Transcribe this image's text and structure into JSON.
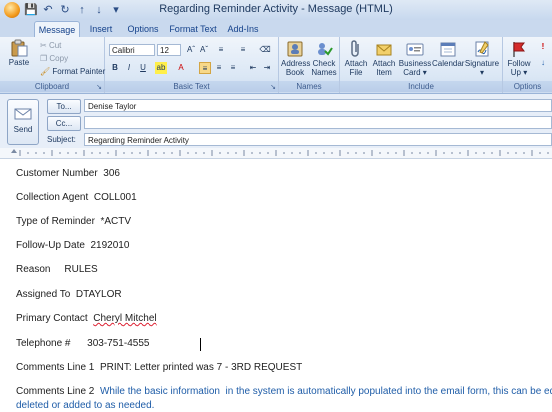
{
  "window": {
    "title": "Regarding Reminder Activity - Message (HTML)"
  },
  "tabs": [
    "Message",
    "Insert",
    "Options",
    "Format Text",
    "Add-Ins"
  ],
  "clipboard": {
    "paste": "Paste",
    "cut": "Cut",
    "copy": "Copy",
    "format_painter": "Format Painter",
    "group": "Clipboard"
  },
  "basic_text": {
    "font": "Calibri",
    "size": "12",
    "group": "Basic Text"
  },
  "names": {
    "address_book": [
      "Address",
      "Book"
    ],
    "check_names": [
      "Check",
      "Names"
    ],
    "group": "Names"
  },
  "include": {
    "attach_file": [
      "Attach",
      "File"
    ],
    "attach_item": [
      "Attach",
      "Item"
    ],
    "business_card": [
      "Business",
      "Card"
    ],
    "calendar": "Calendar",
    "signature": "Signature",
    "group": "Include"
  },
  "options": {
    "follow_up": [
      "Follow",
      "Up"
    ],
    "group": "Options"
  },
  "header": {
    "send": "Send",
    "to_label": "To...",
    "to_value": "Denise Taylor",
    "cc_label": "Cc...",
    "cc_value": "",
    "subject_label": "Subject:",
    "subject_value": "Regarding Reminder Activity"
  },
  "body_lines": [
    {
      "label": "Customer Number",
      "value": "306"
    },
    {
      "label": "Collection Agent",
      "value": "COLL001"
    },
    {
      "label": "Type of Reminder",
      "value": "*ACTV"
    },
    {
      "label": "Follow-Up Date",
      "value": "2192010"
    },
    {
      "label": "Reason",
      "value": "RULES"
    },
    {
      "label": "Assigned To",
      "value": "DTAYLOR"
    },
    {
      "label": "Primary Contact",
      "value": "Cheryl Mitchel"
    },
    {
      "label": "Telephone #",
      "value": "303-751-4555"
    },
    {
      "label": "Comments Line 1",
      "value": "PRINT: Letter printed was 7 - 3RD REQUEST"
    },
    {
      "label": "Comments Line 2",
      "value": "While the basic information  in the system is automatically populated into the email form, this can be edited,"
    },
    {
      "label": "",
      "value": "deleted or added to as needed."
    }
  ],
  "colors": {
    "accent": "#15428b",
    "note": "#1f5da8"
  }
}
